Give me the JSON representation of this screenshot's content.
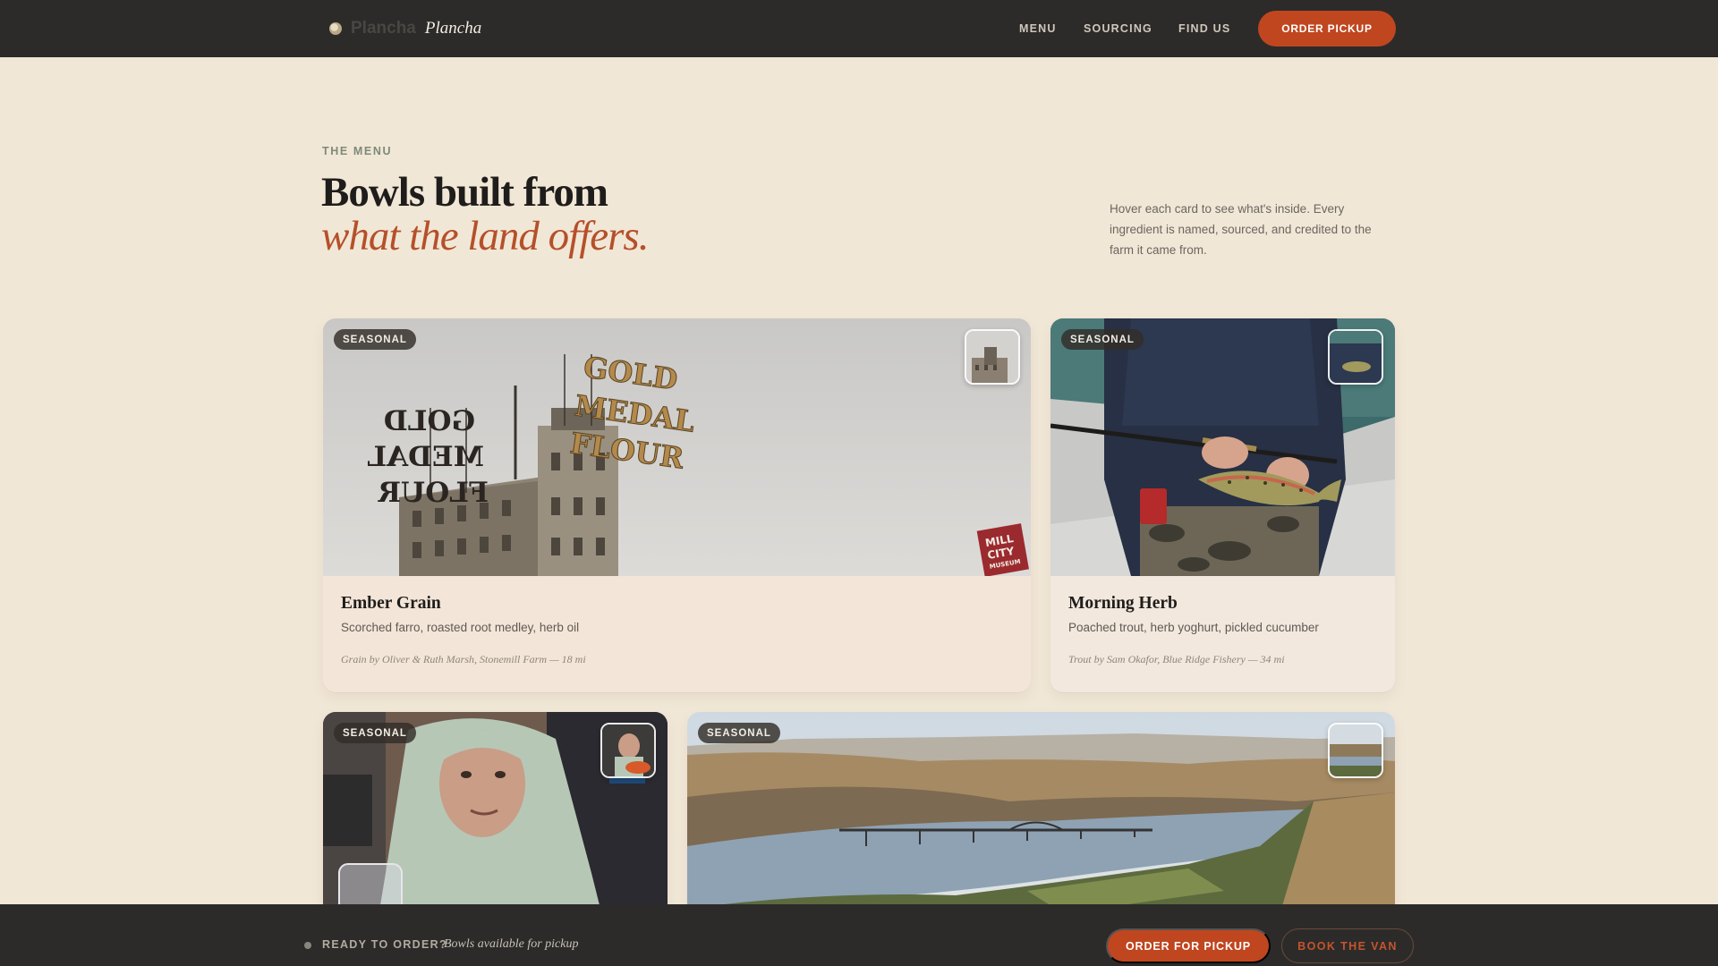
{
  "header": {
    "brand_word": "Plancha",
    "brand_italic": "Plancha",
    "nav": [
      "MENU",
      "SOURCING",
      "FIND US"
    ],
    "order_label": "ORDER PICKUP"
  },
  "hero": {
    "eyebrow": "THE MENU",
    "title_line1": "Bowls built from",
    "title_line2": "what the land offers.",
    "intro": "Hover each card to see what's inside. Every ingredient is named, sourced, and credited to the farm it came from."
  },
  "cards": [
    {
      "badge": "SEASONAL",
      "title": "Ember Grain",
      "desc": "Scorched farro, roasted root medley, herb oil",
      "credit": "Grain by Oliver & Ruth Marsh, Stonemill Farm — 18 mi",
      "sign_left": "GOLD MEDAL FLOUR",
      "sign_right_1": "GOLD",
      "sign_right_2": "MEDAL",
      "sign_right_3": "FLOUR",
      "museum_1": "MILL",
      "museum_2": "CITY",
      "museum_3": "MUSEUM"
    },
    {
      "badge": "SEASONAL",
      "title": "Morning Herb",
      "desc": "Poached trout, herb yoghurt, pickled cucumber",
      "credit": "Trout by Sam Okafor, Blue Ridge Fishery — 34 mi"
    },
    {
      "badge": "SEASONAL"
    },
    {
      "badge": "SEASONAL"
    }
  ],
  "bottom": {
    "ready": "READY TO ORDER?",
    "sub": "Bowls available for pickup",
    "pickup_label": "ORDER FOR PICKUP",
    "van_label": "BOOK THE VAN"
  },
  "colors": {
    "accent": "#c0461f",
    "page_bg": "#f1e7d6",
    "bar_bg": "#2c2b2a",
    "italic_accent": "#b5502a"
  }
}
